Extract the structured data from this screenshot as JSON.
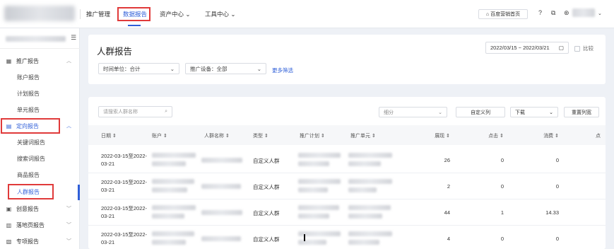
{
  "topbar": {
    "nav": [
      "推广管理",
      "数据报告",
      "资产中心",
      "工具中心"
    ],
    "home_button": "百度营销首页",
    "icons": [
      "help-icon",
      "copy-icon",
      "user-icon"
    ]
  },
  "sidebar": {
    "groups": [
      {
        "label": "推广报告",
        "icon": "chart-icon",
        "expanded": true,
        "items": [
          "账户报告",
          "计划报告",
          "单元报告"
        ]
      },
      {
        "label": "定向报告",
        "icon": "target-icon",
        "expanded": true,
        "items": [
          "关键词报告",
          "搜索词报告",
          "商品报告",
          "人群报告"
        ]
      },
      {
        "label": "创意报告",
        "icon": "creative-icon",
        "expanded": false,
        "items": []
      },
      {
        "label": "落地页报告",
        "icon": "landing-icon",
        "expanded": false,
        "items": []
      },
      {
        "label": "专项报告",
        "icon": "special-icon",
        "expanded": false,
        "items": []
      }
    ],
    "active_item": "人群报告"
  },
  "filters": {
    "title": "人群报告",
    "date_range": "2022/03/15 ~ 2022/03/21",
    "compare_label": "比较",
    "time_unit": "时间单位：合计",
    "device": "推广设备：全部",
    "more": "更多筛选"
  },
  "table_toolbar": {
    "search_placeholder": "请搜索人群名称",
    "breakdown": "细分",
    "custom_column": "自定义列",
    "download": "下载",
    "reset_columns": "重置列宽"
  },
  "table": {
    "columns": [
      "日期 ⇕",
      "账户 ⇕",
      "人群名称 ⇕",
      "类型 ⇕",
      "推广计划 ⇕",
      "推广单元 ⇕",
      "展现 ⇕",
      "点击 ⇕",
      "消费 ⇕",
      "点"
    ],
    "rows": [
      {
        "date_line1": "2022-03-15至2022-",
        "date_line2": "03-21",
        "type": "自定义人群",
        "impressions": "26",
        "clicks": "0",
        "cost": "0"
      },
      {
        "date_line1": "2022-03-15至2022-",
        "date_line2": "03-21",
        "type": "自定义人群",
        "impressions": "2",
        "clicks": "0",
        "cost": "0"
      },
      {
        "date_line1": "2022-03-15至2022-",
        "date_line2": "03-21",
        "type": "自定义人群",
        "impressions": "44",
        "clicks": "1",
        "cost": "14.33"
      },
      {
        "date_line1": "2022-03-15至2022-",
        "date_line2": "03-21",
        "type": "自定义人群",
        "impressions": "4",
        "clicks": "0",
        "cost": "0"
      }
    ]
  },
  "colors": {
    "accent": "#2f5fd8",
    "highlight_box": "#e03a3a"
  }
}
